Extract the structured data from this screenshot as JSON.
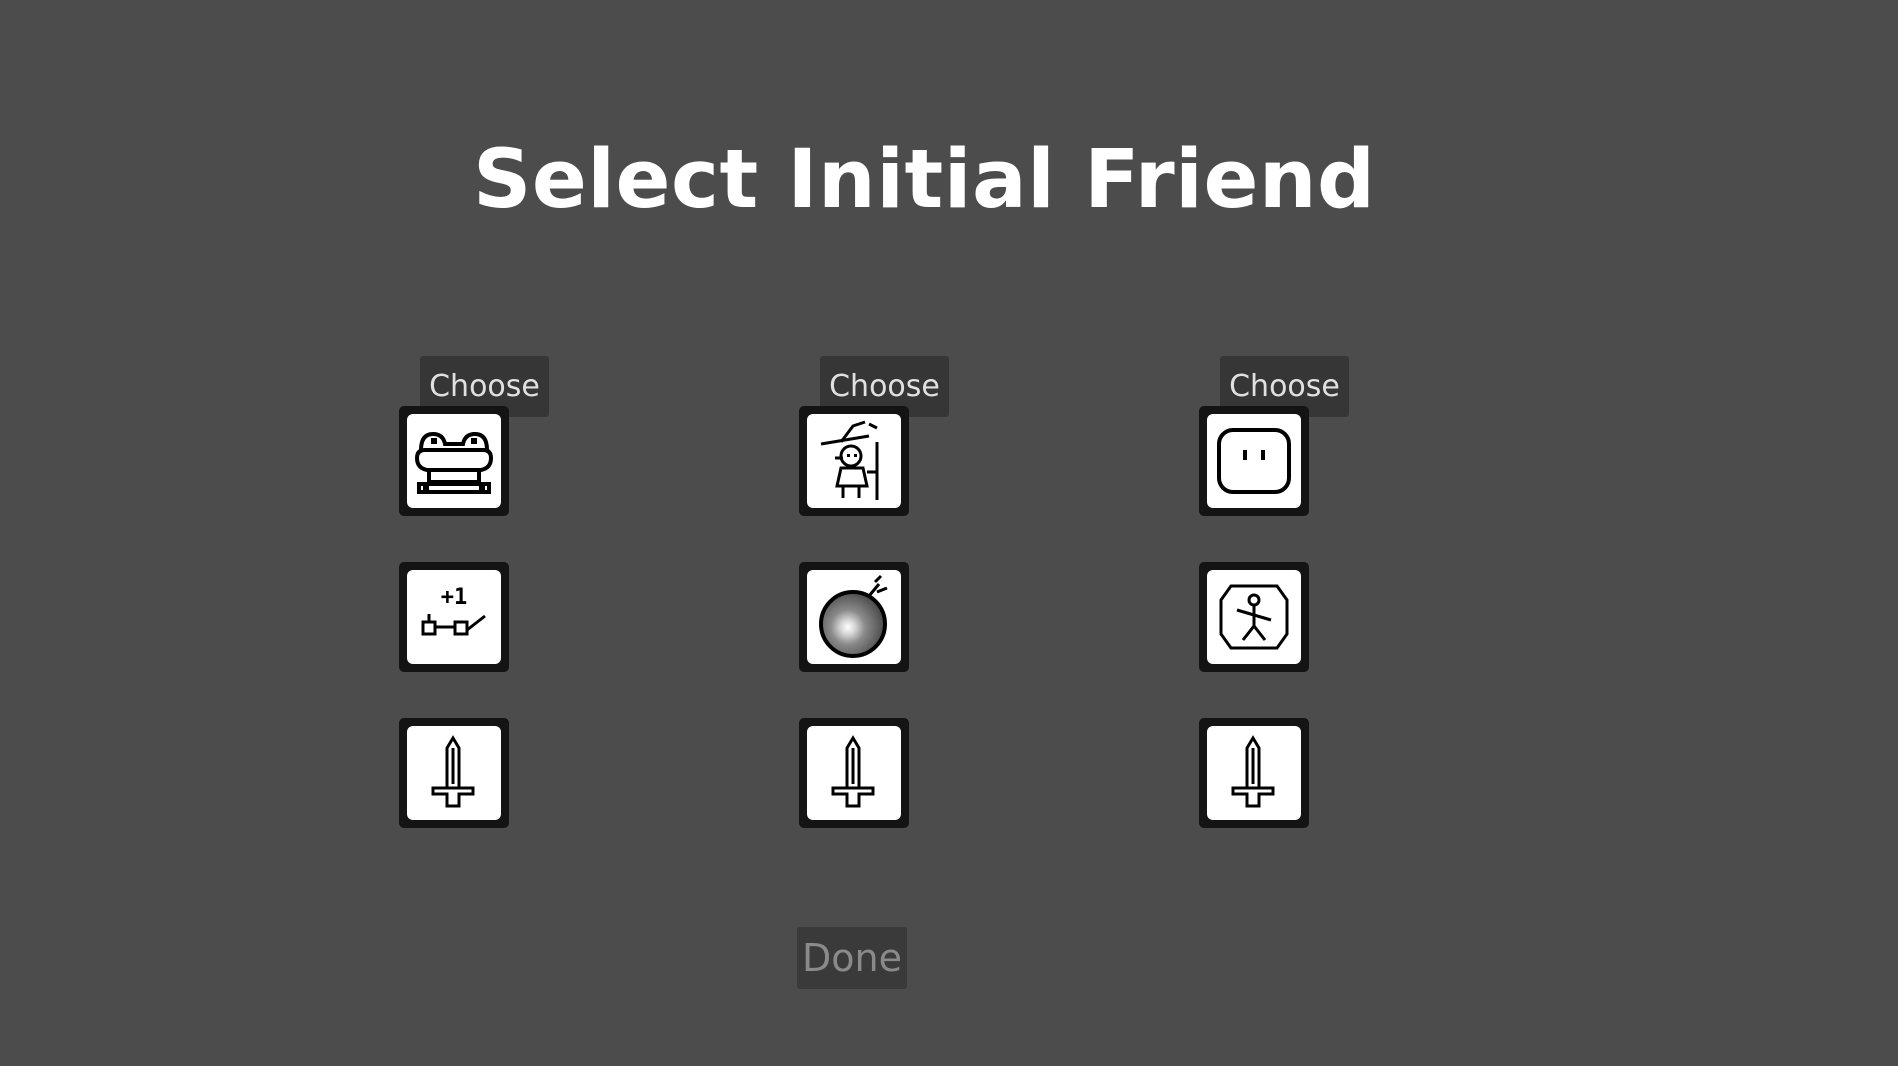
{
  "screen": {
    "title": "Select Initial Friend"
  },
  "options": [
    {
      "choose_label": "Choose",
      "friend": {
        "icon": "frog-icon"
      },
      "item": {
        "icon": "glasses-plus-one-icon",
        "text": "+1"
      },
      "weapon": {
        "icon": "sword-icon"
      }
    },
    {
      "choose_label": "Choose",
      "friend": {
        "icon": "wizard-icon"
      },
      "item": {
        "icon": "bomb-icon"
      },
      "weapon": {
        "icon": "sword-icon"
      }
    },
    {
      "choose_label": "Choose",
      "friend": {
        "icon": "blob-face-icon"
      },
      "item": {
        "icon": "stick-figure-rune-icon"
      },
      "weapon": {
        "icon": "sword-icon"
      }
    }
  ],
  "footer": {
    "done_label": "Done"
  },
  "colors": {
    "background": "#4c4c4c",
    "button": "#363636",
    "card_border": "#141414",
    "card_fill": "#ffffff"
  }
}
